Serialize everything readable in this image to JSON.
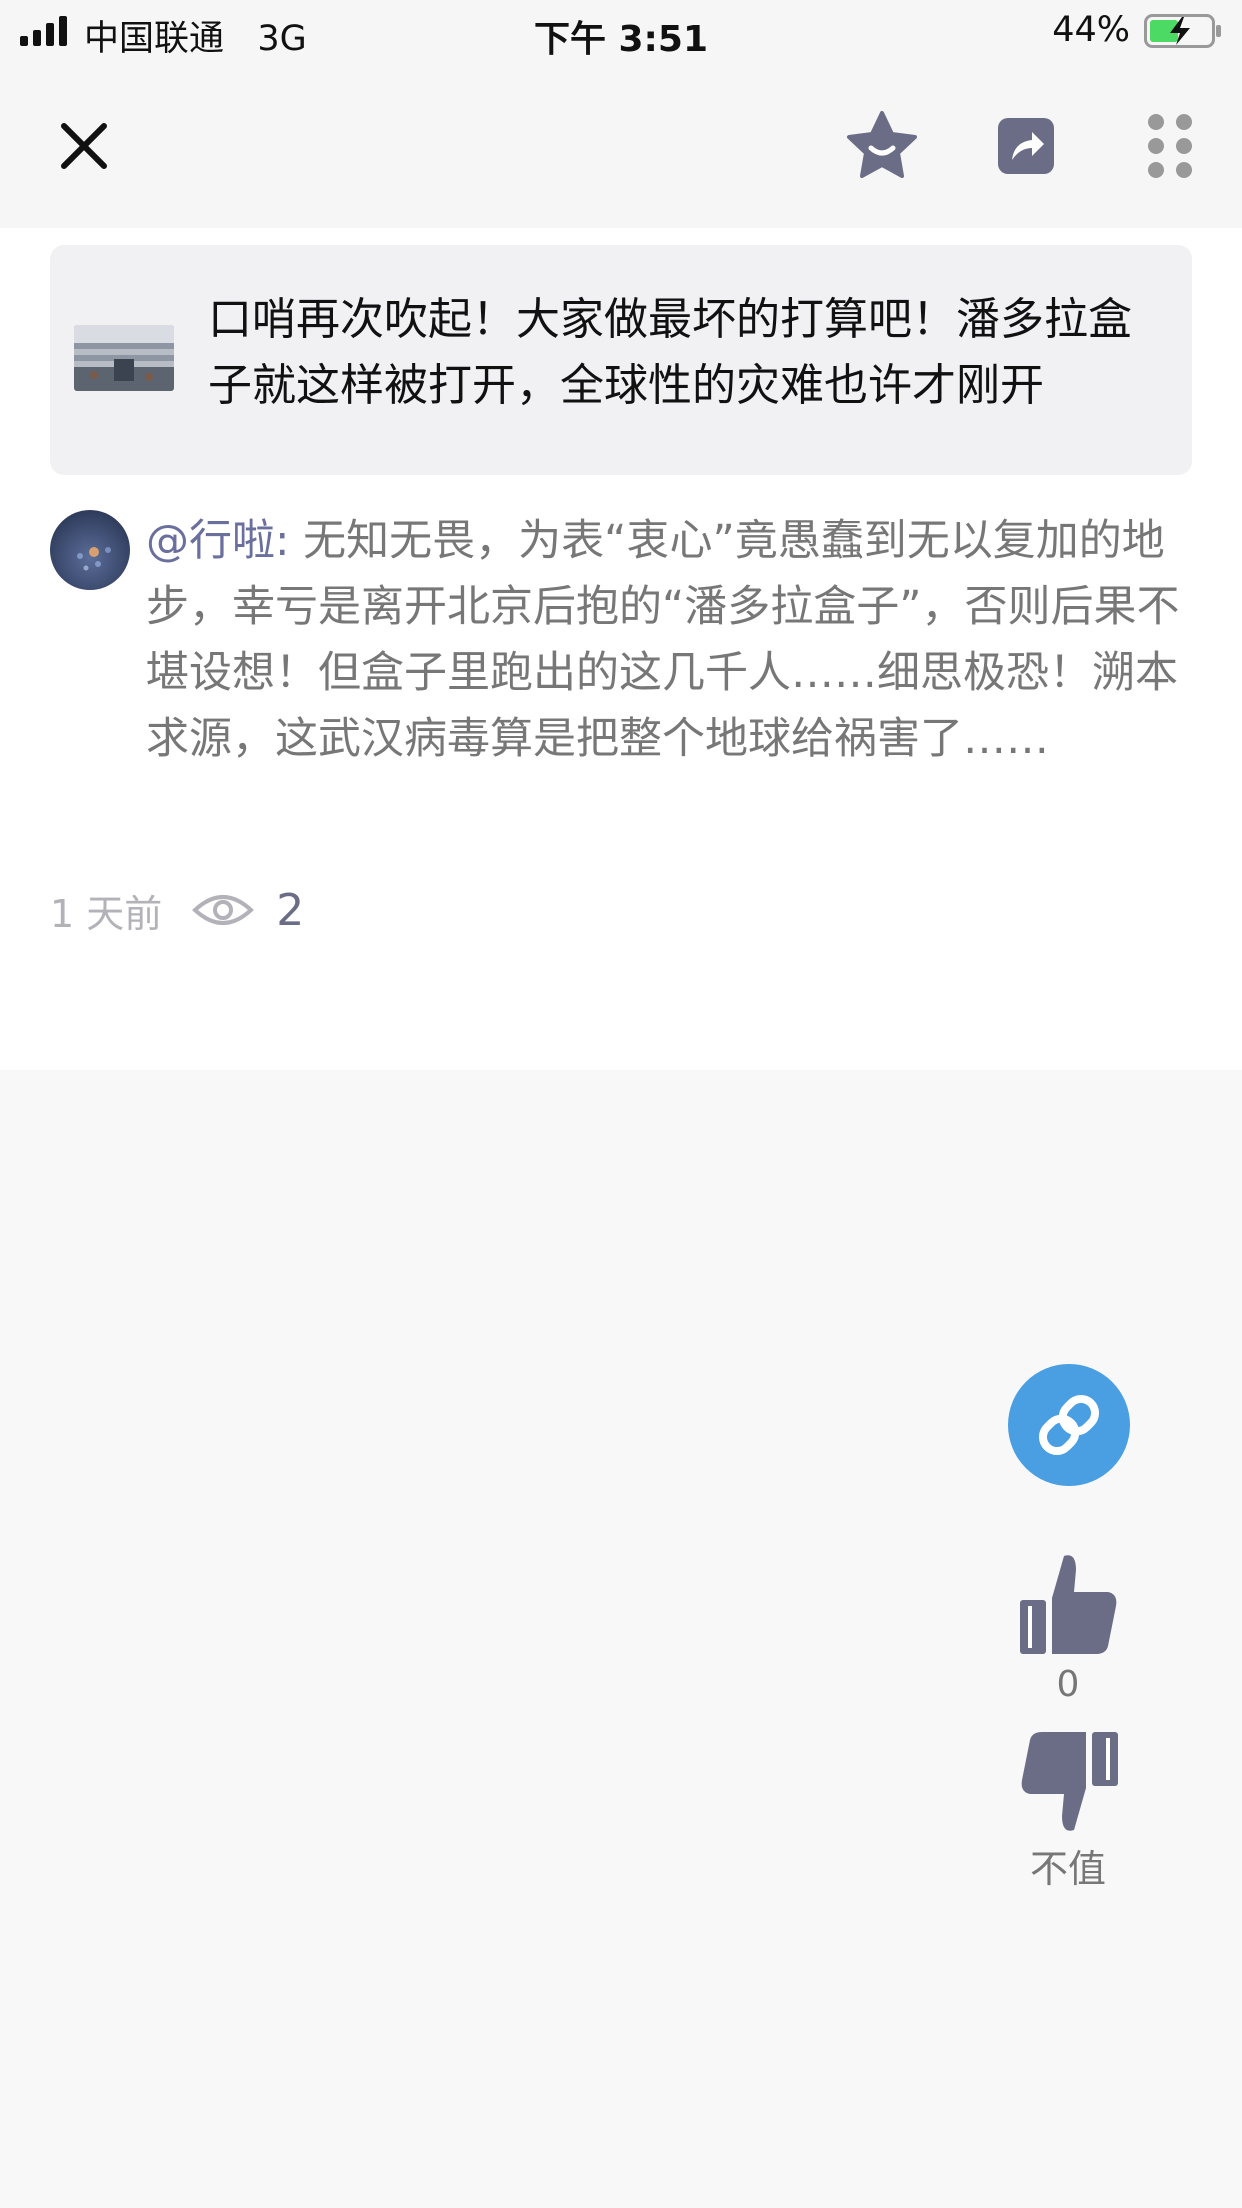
{
  "status_bar": {
    "carrier": "中国联通",
    "network": "3G",
    "time": "下午 3:51",
    "battery_percent": "44%",
    "battery_level": 0.44,
    "charging": true
  },
  "nav": {
    "icons": [
      "close-icon",
      "star-icon",
      "share-icon",
      "more-icon"
    ],
    "icon_color": "#6b6d86"
  },
  "quote_card": {
    "title": "口哨再次吹起！大家做最坏的打算吧！潘多拉盒子就这样被打开，全球性的灾难也许才刚开"
  },
  "comment": {
    "author": "@行啦:",
    "text": "无知无畏，为表“衷心”竟愚蠢到无以复加的地步，幸亏是离开北京后抱的“潘多拉盒子”，否则后果不堪设想！但盒子里跑出的这几千人……细思极恐！溯本求源，这武汉病毒算是把整个地球给祸害了……"
  },
  "meta": {
    "time_ago": "1 天前",
    "views": "2"
  },
  "actions": {
    "like_count": "0",
    "dislike_label": "不值",
    "link_color": "#4a9ee2",
    "thumb_color": "#6b6d86"
  }
}
